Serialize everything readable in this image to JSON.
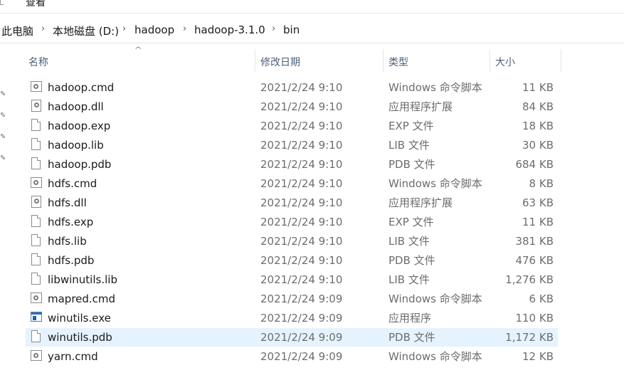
{
  "ribbon": {
    "view_tab": "查看"
  },
  "breadcrumb": [
    "此电脑",
    "本地磁盘 (D:)",
    "hadoop",
    "hadoop-3.1.0",
    "bin"
  ],
  "columns": {
    "name": "名称",
    "date": "修改日期",
    "type": "类型",
    "size": "大小"
  },
  "files": [
    {
      "name": "hadoop.cmd",
      "date": "2021/2/24 9:10",
      "type": "Windows 命令脚本",
      "size": "11 KB",
      "icon": "cmd-file-icon"
    },
    {
      "name": "hadoop.dll",
      "date": "2021/2/24 9:10",
      "type": "应用程序扩展",
      "size": "84 KB",
      "icon": "dll-file-icon"
    },
    {
      "name": "hadoop.exp",
      "date": "2021/2/24 9:10",
      "type": "EXP 文件",
      "size": "18 KB",
      "icon": "blank-file-icon"
    },
    {
      "name": "hadoop.lib",
      "date": "2021/2/24 9:10",
      "type": "LIB 文件",
      "size": "30 KB",
      "icon": "blank-file-icon"
    },
    {
      "name": "hadoop.pdb",
      "date": "2021/2/24 9:10",
      "type": "PDB 文件",
      "size": "684 KB",
      "icon": "blank-file-icon"
    },
    {
      "name": "hdfs.cmd",
      "date": "2021/2/24 9:10",
      "type": "Windows 命令脚本",
      "size": "8 KB",
      "icon": "cmd-file-icon"
    },
    {
      "name": "hdfs.dll",
      "date": "2021/2/24 9:10",
      "type": "应用程序扩展",
      "size": "63 KB",
      "icon": "dll-file-icon"
    },
    {
      "name": "hdfs.exp",
      "date": "2021/2/24 9:10",
      "type": "EXP 文件",
      "size": "11 KB",
      "icon": "blank-file-icon"
    },
    {
      "name": "hdfs.lib",
      "date": "2021/2/24 9:10",
      "type": "LIB 文件",
      "size": "381 KB",
      "icon": "blank-file-icon"
    },
    {
      "name": "hdfs.pdb",
      "date": "2021/2/24 9:10",
      "type": "PDB 文件",
      "size": "476 KB",
      "icon": "blank-file-icon"
    },
    {
      "name": "libwinutils.lib",
      "date": "2021/2/24 9:10",
      "type": "LIB 文件",
      "size": "1,276 KB",
      "icon": "blank-file-icon"
    },
    {
      "name": "mapred.cmd",
      "date": "2021/2/24 9:09",
      "type": "Windows 命令脚本",
      "size": "6 KB",
      "icon": "cmd-file-icon"
    },
    {
      "name": "winutils.exe",
      "date": "2021/2/24 9:09",
      "type": "应用程序",
      "size": "110 KB",
      "icon": "exe-file-icon"
    },
    {
      "name": "winutils.pdb",
      "date": "2021/2/24 9:09",
      "type": "PDB 文件",
      "size": "1,172 KB",
      "icon": "blank-file-icon",
      "selected": true
    },
    {
      "name": "yarn.cmd",
      "date": "2021/2/24 9:09",
      "type": "Windows 命令脚本",
      "size": "12 KB",
      "icon": "cmd-file-icon"
    }
  ],
  "colors": {
    "selection": "#e5f3ff",
    "header_text": "#4c607a",
    "secondary_text": "#6d6d6d"
  }
}
